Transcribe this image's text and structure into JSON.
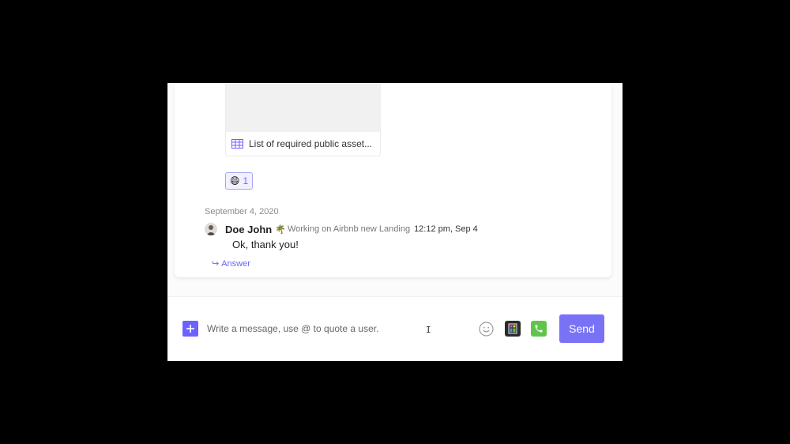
{
  "thread": {
    "attachment": {
      "title": "List of required public asset...",
      "icon": "table-icon"
    },
    "reaction": {
      "emoji": "😄",
      "count": "1"
    },
    "date_divider": "September 4, 2020",
    "message": {
      "author": "Doe John",
      "status_emoji": "🌴",
      "status_text": "Working on Airbnb new Landing",
      "timestamp": "12:12 pm, Sep 4",
      "body": "Ok, thank you!"
    },
    "answer_label": "Answer"
  },
  "composer": {
    "placeholder": "Write a message, use @ to quote a user.",
    "send_label": "Send"
  },
  "colors": {
    "accent": "#6c63ff",
    "send_button": "#7a72f6",
    "call_button": "#5fc54a",
    "doc_button": "#2b2b2b"
  }
}
